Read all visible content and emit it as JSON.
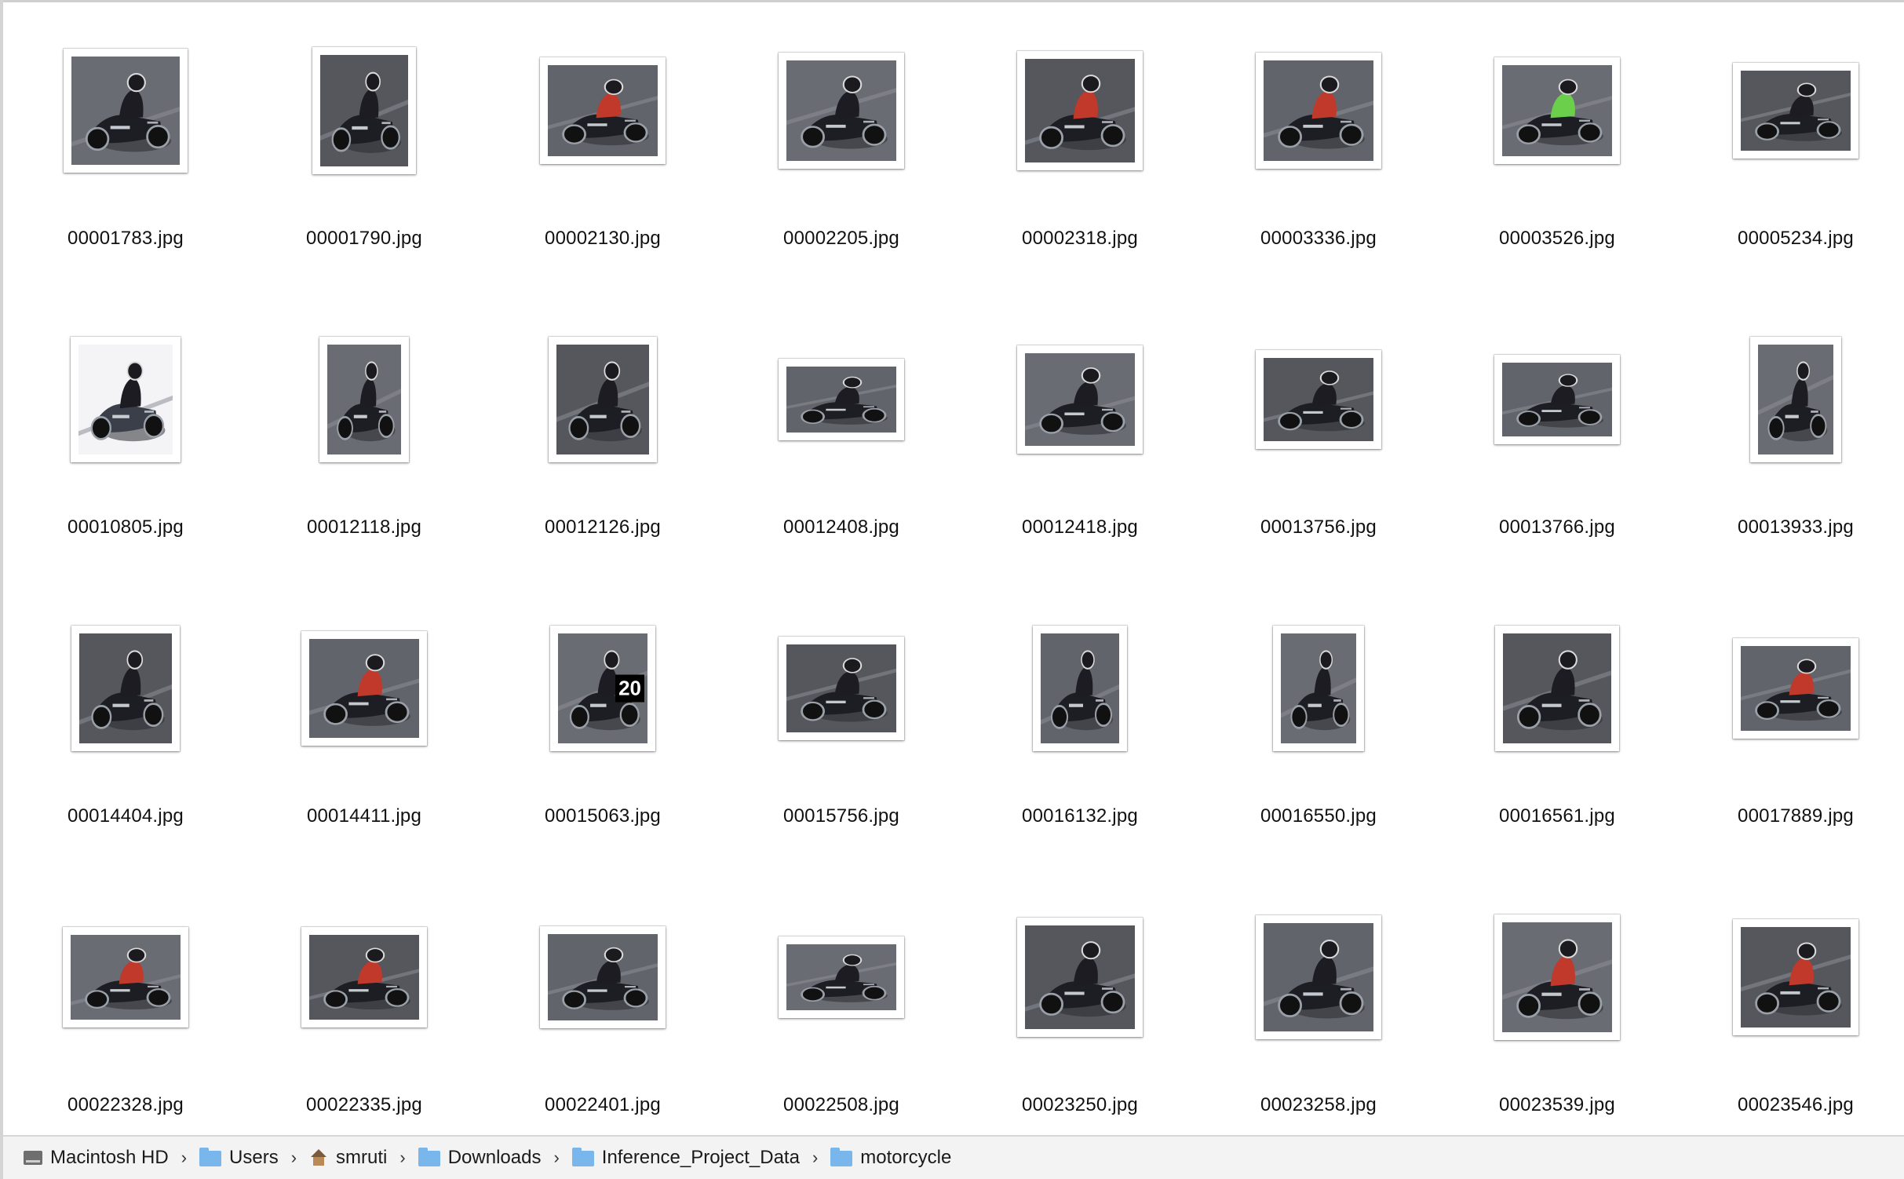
{
  "files": [
    {
      "name": "00001783.jpg",
      "icon": "motorcycle-photo-icon"
    },
    {
      "name": "00001790.jpg",
      "icon": "motorcycle-photo-icon"
    },
    {
      "name": "00002130.jpg",
      "icon": "motorcycle-photo-icon"
    },
    {
      "name": "00002205.jpg",
      "icon": "motorcycle-photo-icon"
    },
    {
      "name": "00002318.jpg",
      "icon": "motorcycle-photo-icon"
    },
    {
      "name": "00003336.jpg",
      "icon": "motorcycle-photo-icon"
    },
    {
      "name": "00003526.jpg",
      "icon": "motorcycle-photo-icon"
    },
    {
      "name": "00005234.jpg",
      "icon": "motorcycle-photo-icon"
    },
    {
      "name": "00010805.jpg",
      "icon": "motorcycle-photo-icon"
    },
    {
      "name": "00012118.jpg",
      "icon": "motorcycle-photo-icon"
    },
    {
      "name": "00012126.jpg",
      "icon": "motorcycle-photo-icon"
    },
    {
      "name": "00012408.jpg",
      "icon": "motorcycle-photo-icon"
    },
    {
      "name": "00012418.jpg",
      "icon": "motorcycle-photo-icon"
    },
    {
      "name": "00013756.jpg",
      "icon": "motorcycle-photo-icon"
    },
    {
      "name": "00013766.jpg",
      "icon": "motorcycle-photo-icon"
    },
    {
      "name": "00013933.jpg",
      "icon": "motorcycle-photo-icon"
    },
    {
      "name": "00014404.jpg",
      "icon": "motorcycle-photo-icon"
    },
    {
      "name": "00014411.jpg",
      "icon": "motorcycle-photo-icon"
    },
    {
      "name": "00015063.jpg",
      "icon": "motorcycle-photo-icon",
      "overlay_text": "20"
    },
    {
      "name": "00015756.jpg",
      "icon": "motorcycle-photo-icon"
    },
    {
      "name": "00016132.jpg",
      "icon": "motorcycle-photo-icon"
    },
    {
      "name": "00016550.jpg",
      "icon": "motorcycle-photo-icon"
    },
    {
      "name": "00016561.jpg",
      "icon": "motorcycle-photo-icon"
    },
    {
      "name": "00017889.jpg",
      "icon": "motorcycle-photo-icon"
    },
    {
      "name": "00022328.jpg",
      "icon": "motorcycle-photo-icon"
    },
    {
      "name": "00022335.jpg",
      "icon": "motorcycle-photo-icon"
    },
    {
      "name": "00022401.jpg",
      "icon": "motorcycle-photo-icon"
    },
    {
      "name": "00022508.jpg",
      "icon": "motorcycle-photo-icon"
    },
    {
      "name": "00023250.jpg",
      "icon": "motorcycle-photo-icon"
    },
    {
      "name": "00023258.jpg",
      "icon": "motorcycle-photo-icon"
    },
    {
      "name": "00023539.jpg",
      "icon": "motorcycle-photo-icon"
    },
    {
      "name": "00023546.jpg",
      "icon": "motorcycle-photo-icon"
    }
  ],
  "path_bar": {
    "items": [
      {
        "label": "Macintosh HD",
        "icon": "hard-drive-icon"
      },
      {
        "label": "Users",
        "icon": "folder-icon"
      },
      {
        "label": "smruti",
        "icon": "home-icon"
      },
      {
        "label": "Downloads",
        "icon": "folder-icon"
      },
      {
        "label": "Inference_Project_Data",
        "icon": "folder-icon"
      },
      {
        "label": "motorcycle",
        "icon": "folder-icon"
      }
    ],
    "separator": "›"
  },
  "colors": {
    "asphalt": "#5b5d63",
    "rider_dark": "#1c1c22",
    "highlight_red": "#c0392b",
    "highlight_green": "#6ccf4b",
    "folder_blue": "#78b6ec"
  }
}
